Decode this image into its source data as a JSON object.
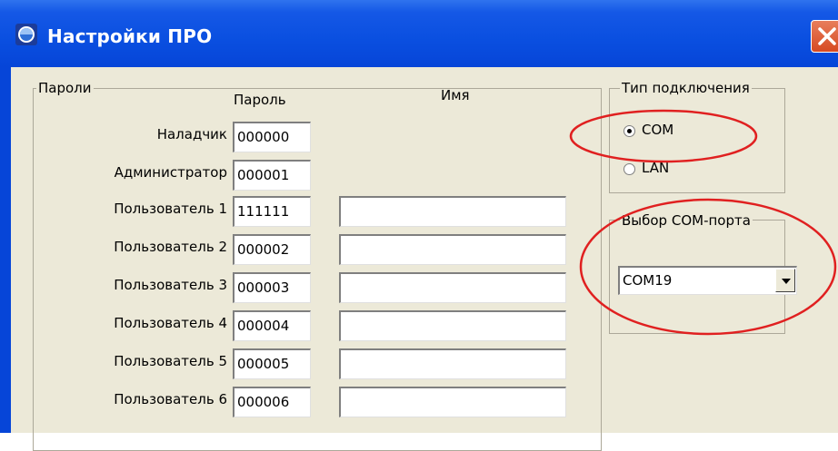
{
  "window": {
    "title": "Настройки ПРО",
    "close_icon": "close-x"
  },
  "passwords": {
    "group_title": "Пароли",
    "col_password": "Пароль",
    "col_name": "Имя",
    "rows": [
      {
        "label": "Наладчик",
        "password": "000000",
        "name": null
      },
      {
        "label": "Администратор",
        "password": "000001",
        "name": null
      },
      {
        "label": "Пользователь 1",
        "password": "111111",
        "name": ""
      },
      {
        "label": "Пользователь 2",
        "password": "000002",
        "name": ""
      },
      {
        "label": "Пользователь 3",
        "password": "000003",
        "name": ""
      },
      {
        "label": "Пользователь 4",
        "password": "000004",
        "name": ""
      },
      {
        "label": "Пользователь 5",
        "password": "000005",
        "name": ""
      },
      {
        "label": "Пользователь 6",
        "password": "000006",
        "name": ""
      }
    ]
  },
  "connection": {
    "group_title": "Тип подключения",
    "options": [
      {
        "label": "COM",
        "checked": true
      },
      {
        "label": "LAN",
        "checked": false
      }
    ]
  },
  "com_port": {
    "group_title": "Выбор COM-порта",
    "selected": "COM19"
  },
  "annotations": {
    "highlight_color": "#e02020"
  }
}
